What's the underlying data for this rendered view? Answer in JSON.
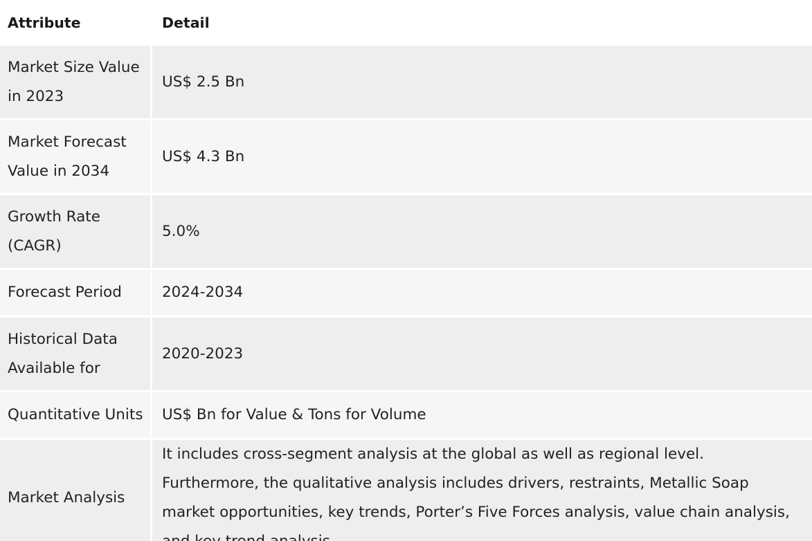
{
  "table": {
    "headers": {
      "attribute": "Attribute",
      "detail": "Detail"
    },
    "rows": [
      {
        "attribute": "Market Size Value in 2023",
        "detail": "US$ 2.5 Bn"
      },
      {
        "attribute": "Market Forecast Value in 2034",
        "detail": "US$ 4.3 Bn"
      },
      {
        "attribute": "Growth Rate (CAGR)",
        "detail": "5.0%"
      },
      {
        "attribute": "Forecast Period",
        "detail": "2024-2034"
      },
      {
        "attribute": "Historical Data Available for",
        "detail": "2020-2023"
      },
      {
        "attribute": "Quantitative Units",
        "detail": "US$ Bn for Value & Tons for Volume"
      },
      {
        "attribute": "Market Analysis",
        "detail": "It includes cross-segment analysis at the global as well as regional level. Furthermore, the qualitative analysis includes drivers, restraints, Metallic Soap market opportunities, key trends, Porter’s Five Forces analysis, value chain analysis, and key trend analysis."
      }
    ]
  }
}
